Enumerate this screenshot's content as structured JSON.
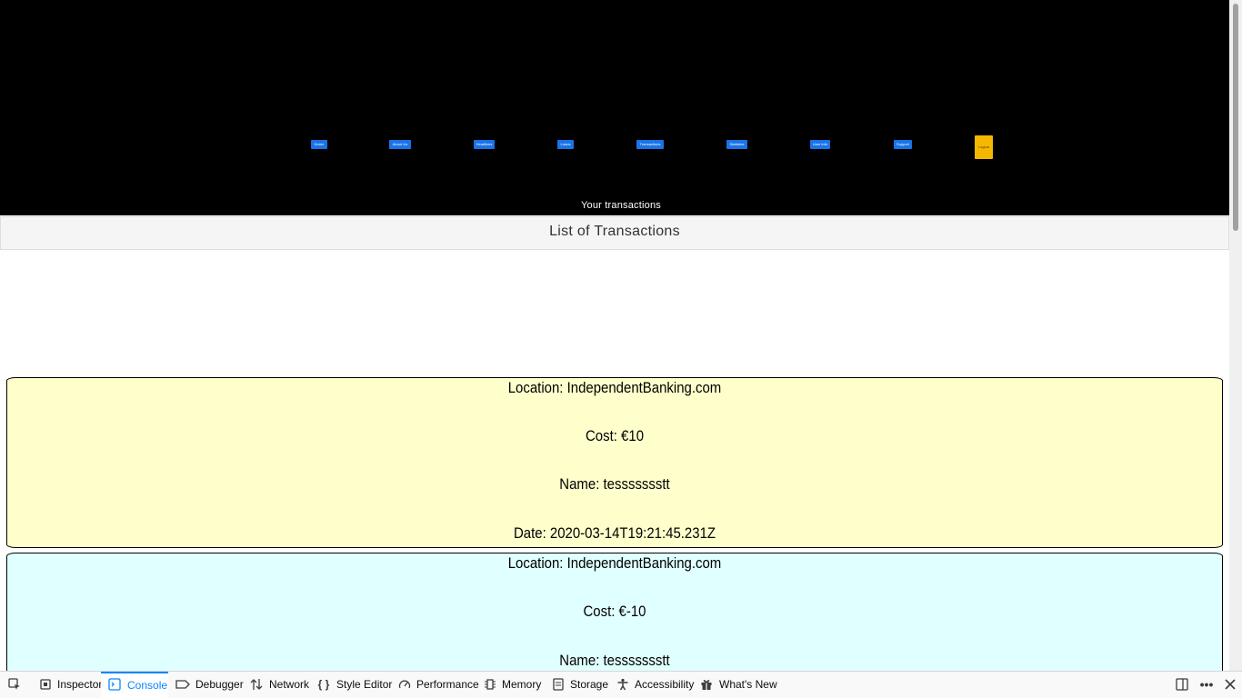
{
  "header": {
    "nav": [
      {
        "label": "Home"
      },
      {
        "label": "About Us"
      },
      {
        "label": "Headlines"
      },
      {
        "label": "Loans"
      },
      {
        "label": "Transactions"
      },
      {
        "label": "Statistics"
      },
      {
        "label": "User Info"
      },
      {
        "label": "Support"
      },
      {
        "label": "Logout"
      }
    ],
    "caption": "Your transactions",
    "colors": {
      "nav": "#1a73e8",
      "logout": "#f5b800",
      "background": "#000000"
    }
  },
  "list_title": "List of Transactions",
  "transactions": [
    {
      "location": "Location: IndependentBanking.com",
      "cost": "Cost: €10",
      "name": "Name: tessssssstt",
      "date": "Date: 2020-03-14T19:21:45.231Z",
      "color": "#ffffcc"
    },
    {
      "location": "Location: IndependentBanking.com",
      "cost": "Cost: €-10",
      "name": "Name: tessssssstt",
      "color": "#e0ffff"
    }
  ],
  "devtools": {
    "tabs": [
      {
        "label": "Inspector",
        "icon": "inspector-icon"
      },
      {
        "label": "Console",
        "icon": "console-icon",
        "active": true
      },
      {
        "label": "Debugger",
        "icon": "debugger-icon"
      },
      {
        "label": "Network",
        "icon": "network-icon"
      },
      {
        "label": "Style Editor",
        "icon": "style-editor-icon"
      },
      {
        "label": "Performance",
        "icon": "performance-icon"
      },
      {
        "label": "Memory",
        "icon": "memory-icon"
      },
      {
        "label": "Storage",
        "icon": "storage-icon"
      },
      {
        "label": "Accessibility",
        "icon": "accessibility-icon"
      },
      {
        "label": "What's New",
        "icon": "gift-icon"
      }
    ]
  }
}
